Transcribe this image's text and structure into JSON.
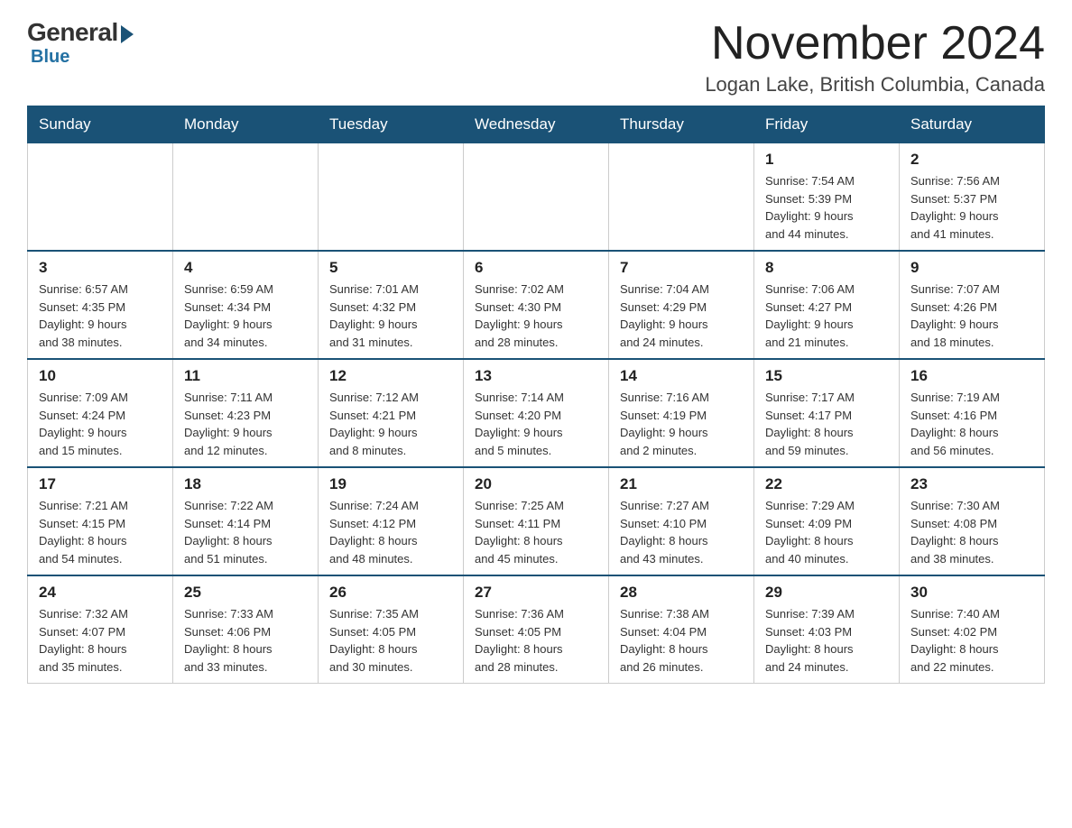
{
  "logo": {
    "general": "General",
    "blue": "Blue"
  },
  "header": {
    "month": "November 2024",
    "location": "Logan Lake, British Columbia, Canada"
  },
  "weekdays": [
    "Sunday",
    "Monday",
    "Tuesday",
    "Wednesday",
    "Thursday",
    "Friday",
    "Saturday"
  ],
  "weeks": [
    {
      "days": [
        {
          "num": "",
          "info": ""
        },
        {
          "num": "",
          "info": ""
        },
        {
          "num": "",
          "info": ""
        },
        {
          "num": "",
          "info": ""
        },
        {
          "num": "",
          "info": ""
        },
        {
          "num": "1",
          "info": "Sunrise: 7:54 AM\nSunset: 5:39 PM\nDaylight: 9 hours\nand 44 minutes."
        },
        {
          "num": "2",
          "info": "Sunrise: 7:56 AM\nSunset: 5:37 PM\nDaylight: 9 hours\nand 41 minutes."
        }
      ]
    },
    {
      "days": [
        {
          "num": "3",
          "info": "Sunrise: 6:57 AM\nSunset: 4:35 PM\nDaylight: 9 hours\nand 38 minutes."
        },
        {
          "num": "4",
          "info": "Sunrise: 6:59 AM\nSunset: 4:34 PM\nDaylight: 9 hours\nand 34 minutes."
        },
        {
          "num": "5",
          "info": "Sunrise: 7:01 AM\nSunset: 4:32 PM\nDaylight: 9 hours\nand 31 minutes."
        },
        {
          "num": "6",
          "info": "Sunrise: 7:02 AM\nSunset: 4:30 PM\nDaylight: 9 hours\nand 28 minutes."
        },
        {
          "num": "7",
          "info": "Sunrise: 7:04 AM\nSunset: 4:29 PM\nDaylight: 9 hours\nand 24 minutes."
        },
        {
          "num": "8",
          "info": "Sunrise: 7:06 AM\nSunset: 4:27 PM\nDaylight: 9 hours\nand 21 minutes."
        },
        {
          "num": "9",
          "info": "Sunrise: 7:07 AM\nSunset: 4:26 PM\nDaylight: 9 hours\nand 18 minutes."
        }
      ]
    },
    {
      "days": [
        {
          "num": "10",
          "info": "Sunrise: 7:09 AM\nSunset: 4:24 PM\nDaylight: 9 hours\nand 15 minutes."
        },
        {
          "num": "11",
          "info": "Sunrise: 7:11 AM\nSunset: 4:23 PM\nDaylight: 9 hours\nand 12 minutes."
        },
        {
          "num": "12",
          "info": "Sunrise: 7:12 AM\nSunset: 4:21 PM\nDaylight: 9 hours\nand 8 minutes."
        },
        {
          "num": "13",
          "info": "Sunrise: 7:14 AM\nSunset: 4:20 PM\nDaylight: 9 hours\nand 5 minutes."
        },
        {
          "num": "14",
          "info": "Sunrise: 7:16 AM\nSunset: 4:19 PM\nDaylight: 9 hours\nand 2 minutes."
        },
        {
          "num": "15",
          "info": "Sunrise: 7:17 AM\nSunset: 4:17 PM\nDaylight: 8 hours\nand 59 minutes."
        },
        {
          "num": "16",
          "info": "Sunrise: 7:19 AM\nSunset: 4:16 PM\nDaylight: 8 hours\nand 56 minutes."
        }
      ]
    },
    {
      "days": [
        {
          "num": "17",
          "info": "Sunrise: 7:21 AM\nSunset: 4:15 PM\nDaylight: 8 hours\nand 54 minutes."
        },
        {
          "num": "18",
          "info": "Sunrise: 7:22 AM\nSunset: 4:14 PM\nDaylight: 8 hours\nand 51 minutes."
        },
        {
          "num": "19",
          "info": "Sunrise: 7:24 AM\nSunset: 4:12 PM\nDaylight: 8 hours\nand 48 minutes."
        },
        {
          "num": "20",
          "info": "Sunrise: 7:25 AM\nSunset: 4:11 PM\nDaylight: 8 hours\nand 45 minutes."
        },
        {
          "num": "21",
          "info": "Sunrise: 7:27 AM\nSunset: 4:10 PM\nDaylight: 8 hours\nand 43 minutes."
        },
        {
          "num": "22",
          "info": "Sunrise: 7:29 AM\nSunset: 4:09 PM\nDaylight: 8 hours\nand 40 minutes."
        },
        {
          "num": "23",
          "info": "Sunrise: 7:30 AM\nSunset: 4:08 PM\nDaylight: 8 hours\nand 38 minutes."
        }
      ]
    },
    {
      "days": [
        {
          "num": "24",
          "info": "Sunrise: 7:32 AM\nSunset: 4:07 PM\nDaylight: 8 hours\nand 35 minutes."
        },
        {
          "num": "25",
          "info": "Sunrise: 7:33 AM\nSunset: 4:06 PM\nDaylight: 8 hours\nand 33 minutes."
        },
        {
          "num": "26",
          "info": "Sunrise: 7:35 AM\nSunset: 4:05 PM\nDaylight: 8 hours\nand 30 minutes."
        },
        {
          "num": "27",
          "info": "Sunrise: 7:36 AM\nSunset: 4:05 PM\nDaylight: 8 hours\nand 28 minutes."
        },
        {
          "num": "28",
          "info": "Sunrise: 7:38 AM\nSunset: 4:04 PM\nDaylight: 8 hours\nand 26 minutes."
        },
        {
          "num": "29",
          "info": "Sunrise: 7:39 AM\nSunset: 4:03 PM\nDaylight: 8 hours\nand 24 minutes."
        },
        {
          "num": "30",
          "info": "Sunrise: 7:40 AM\nSunset: 4:02 PM\nDaylight: 8 hours\nand 22 minutes."
        }
      ]
    }
  ]
}
